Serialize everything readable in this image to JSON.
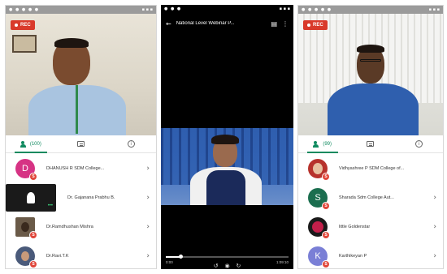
{
  "left": {
    "status_time": "",
    "rec_label": "REC",
    "tabs": [
      {
        "label": "(100)",
        "icon": "people-icon",
        "active": true
      },
      {
        "label": "",
        "icon": "chat-icon",
        "active": false
      },
      {
        "label": "",
        "icon": "info-icon",
        "active": false
      }
    ],
    "participants": [
      {
        "name": "DHANUSH R SDM College...",
        "initial": "D",
        "color": "#d63384"
      },
      {
        "name": "Dr. Gajanana Prabhu B.",
        "initial": "",
        "color": "#222222"
      },
      {
        "name": "Dr.Ramdhushan Mishra",
        "initial": "",
        "color": "#6a5a48"
      },
      {
        "name": "Dr.Ravi.T.K",
        "initial": "",
        "color": "#4a5a7a"
      }
    ],
    "badge_label": "S",
    "chevron": "›"
  },
  "middle": {
    "title": "National Level Webinar P...",
    "back_icon": "arrow-left-icon",
    "time_elapsed": "0:00",
    "time_total": "1:09:10",
    "progress": 0.12
  },
  "right": {
    "rec_label": "REC",
    "tabs": [
      {
        "label": "(99)",
        "icon": "people-icon",
        "active": true
      },
      {
        "label": "",
        "icon": "chat-icon",
        "active": false
      },
      {
        "label": "",
        "icon": "info-icon",
        "active": false
      }
    ],
    "participants": [
      {
        "name": "Vidhyashree P SDM College of...",
        "initial": "",
        "color": "#b7322c"
      },
      {
        "name": "Sharada Sdm College Aut...",
        "initial": "S",
        "color": "#1b6e4f"
      },
      {
        "name": "little Goldenstar",
        "initial": "",
        "color": "#c21f4a"
      },
      {
        "name": "Karthikeyan P",
        "initial": "K",
        "color": "#7a7fd6"
      }
    ],
    "badge_label": "S",
    "chevron": "›"
  }
}
